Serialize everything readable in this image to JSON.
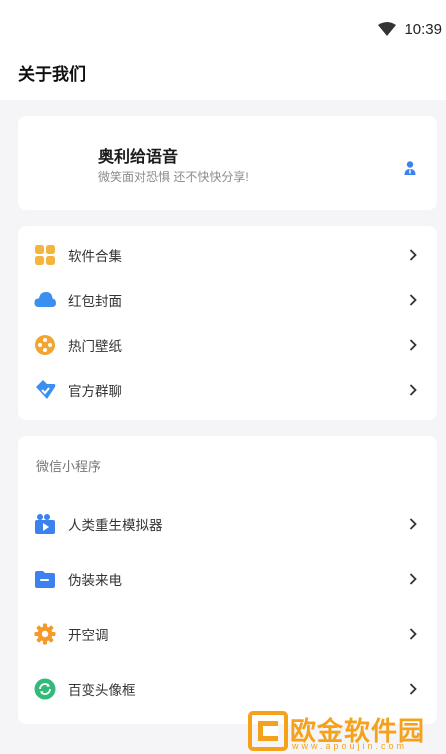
{
  "status_bar": {
    "time": "10:39",
    "wifi_icon": "wifi-icon"
  },
  "page_title": "关于我们",
  "profile": {
    "name": "奥利给语音",
    "slogan": "微笑面对恐惧 还不快快分享!",
    "user_icon": "person-icon"
  },
  "menu": {
    "items": [
      {
        "label": "软件合集",
        "icon": "grid-icon",
        "color": "#f5b43d"
      },
      {
        "label": "红包封面",
        "icon": "cloud-icon",
        "color": "#3b8ff0"
      },
      {
        "label": "热门壁纸",
        "icon": "film-reel-icon",
        "color": "#f3a531"
      },
      {
        "label": "官方群聊",
        "icon": "chat-heart-icon",
        "color": "#3b8ff0"
      }
    ]
  },
  "mini_programs": {
    "title": "微信小程序",
    "items": [
      {
        "label": "人类重生模拟器",
        "icon": "video-camera-icon",
        "color": "#3b82f0"
      },
      {
        "label": "伪装来电",
        "icon": "folder-icon",
        "color": "#3b82f0"
      },
      {
        "label": "开空调",
        "icon": "gear-icon",
        "color": "#f39a2b"
      },
      {
        "label": "百变头像框",
        "icon": "refresh-icon",
        "color": "#33b97a"
      }
    ]
  },
  "watermark": {
    "text": "欧金软件园",
    "url": "www.apoujin.com",
    "color": "#f6a11a"
  }
}
